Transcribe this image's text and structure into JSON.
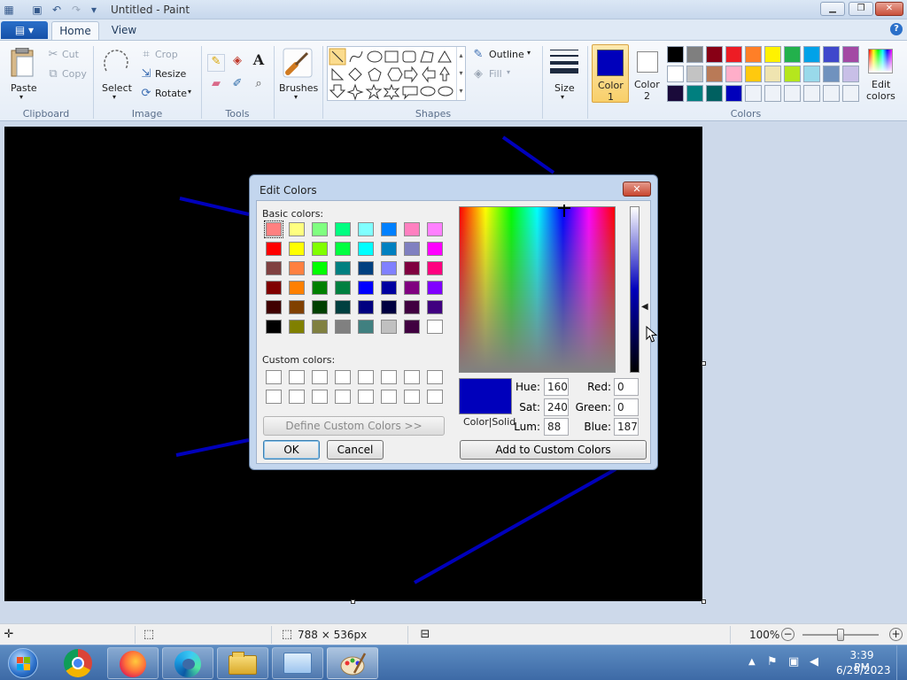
{
  "window": {
    "title": "Untitled - Paint"
  },
  "tabs": {
    "home": "Home",
    "view": "View"
  },
  "clipboard": {
    "paste": "Paste",
    "cut": "Cut",
    "copy": "Copy",
    "group": "Clipboard"
  },
  "image": {
    "select": "Select",
    "crop": "Crop",
    "resize": "Resize",
    "rotate": "Rotate",
    "group": "Image"
  },
  "tools": {
    "group": "Tools",
    "text_tool": "A"
  },
  "brushes": {
    "label": "Brushes"
  },
  "shapes": {
    "outline": "Outline",
    "fill": "Fill",
    "group": "Shapes"
  },
  "size": {
    "label": "Size"
  },
  "colors": {
    "color1_line1": "Color",
    "color1_line2": "1",
    "color2_line1": "Color",
    "color2_line2": "2",
    "edit_line1": "Edit",
    "edit_line2": "colors",
    "group": "Colors",
    "color1": "#0000bb",
    "color2": "#ffffff",
    "palette": [
      [
        "#000000",
        "#7f7f7f",
        "#880015",
        "#ed1c24",
        "#ff7f27",
        "#fff200",
        "#22b14c",
        "#00a2e8",
        "#3f48cc",
        "#a349a4"
      ],
      [
        "#ffffff",
        "#c3c3c3",
        "#b97a57",
        "#ffaec9",
        "#ffc90e",
        "#efe4b0",
        "#b5e61d",
        "#99d9ea",
        "#7092be",
        "#c8bfe7"
      ],
      [
        "#1a0a3a",
        "#007f7f",
        "#006060",
        "#0000bb",
        "#eef2f8",
        "#eef2f8",
        "#eef2f8",
        "#eef2f8",
        "#eef2f8",
        "#eef2f8"
      ]
    ]
  },
  "dialog": {
    "title": "Edit Colors",
    "basic_label": "Basic colors:",
    "custom_label": "Custom colors:",
    "define_button": "Define Custom Colors >>",
    "ok": "OK",
    "cancel": "Cancel",
    "add_custom": "Add to Custom Colors",
    "preview_label": "Color|Solid",
    "hue_label": "Hue:",
    "hue": "160",
    "sat_label": "Sat:",
    "sat": "240",
    "lum_label": "Lum:",
    "lum": "88",
    "red_label": "Red:",
    "red": "0",
    "green_label": "Green:",
    "green": "0",
    "blue_label": "Blue:",
    "blue": "187",
    "preview_color": "#0000bb",
    "basic_colors": [
      [
        "#ff8080",
        "#ffff80",
        "#80ff80",
        "#00ff80",
        "#80ffff",
        "#0080ff",
        "#ff80c0",
        "#ff80ff"
      ],
      [
        "#ff0000",
        "#ffff00",
        "#80ff00",
        "#00ff40",
        "#00ffff",
        "#0080c0",
        "#8080c0",
        "#ff00ff"
      ],
      [
        "#804040",
        "#ff8040",
        "#00ff00",
        "#008080",
        "#004080",
        "#8080ff",
        "#800040",
        "#ff0080"
      ],
      [
        "#800000",
        "#ff8000",
        "#008000",
        "#008040",
        "#0000ff",
        "#0000a0",
        "#800080",
        "#8000ff"
      ],
      [
        "#400000",
        "#804000",
        "#004000",
        "#004040",
        "#000080",
        "#000040",
        "#400040",
        "#400080"
      ],
      [
        "#000000",
        "#808000",
        "#808040",
        "#808080",
        "#408080",
        "#c0c0c0",
        "#400040",
        "#ffffff"
      ]
    ]
  },
  "status": {
    "dimensions": "788 × 536px",
    "zoom": "100%"
  },
  "taskbar": {
    "time": "3:39 PM",
    "date": "6/29/2023"
  }
}
